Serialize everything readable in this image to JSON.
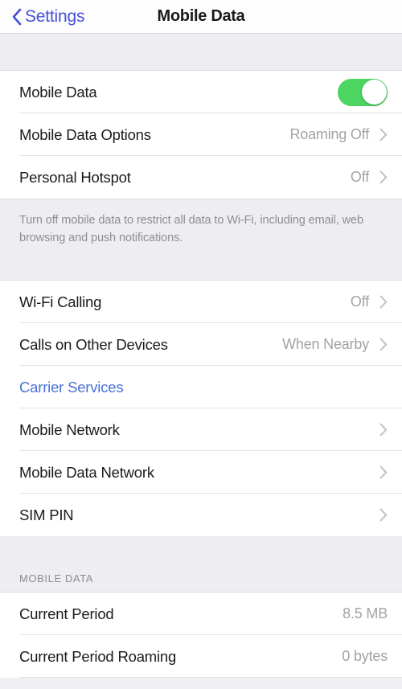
{
  "navbar": {
    "back_label": "Settings",
    "title": "Mobile Data"
  },
  "groups": [
    {
      "id": "data-group",
      "rows": [
        {
          "label": "Mobile Data",
          "control": "toggle",
          "toggle_on": true,
          "value": ""
        },
        {
          "label": "Mobile Data Options",
          "control": "chevron",
          "value": "Roaming Off"
        },
        {
          "label": "Personal Hotspot",
          "control": "chevron",
          "value": "Off"
        }
      ]
    },
    {
      "id": "calling-group",
      "rows": [
        {
          "label": "Wi-Fi Calling",
          "control": "chevron",
          "value": "Off"
        },
        {
          "label": "Calls on Other Devices",
          "control": "chevron",
          "value": "When Nearby"
        },
        {
          "label": "Carrier Services",
          "control": "none",
          "value": "",
          "style": "link"
        },
        {
          "label": "Mobile Network",
          "control": "chevron",
          "value": ""
        },
        {
          "label": "Mobile Data Network",
          "control": "chevron",
          "value": ""
        },
        {
          "label": "SIM PIN",
          "control": "chevron",
          "value": ""
        }
      ]
    },
    {
      "id": "usage-group",
      "header": "MOBILE DATA",
      "rows": [
        {
          "label": "Current Period",
          "control": "none",
          "value": "8.5 MB"
        },
        {
          "label": "Current Period Roaming",
          "control": "none",
          "value": "0 bytes"
        }
      ]
    }
  ],
  "footer_note": "Turn off mobile data to restrict all data to Wi-Fi, including email, web browsing and push notifications.",
  "colors": {
    "tint_back": "#4550d8",
    "tint_link": "#4a71d8",
    "toggle_on": "#4cd661",
    "value_gray": "#a3a3a8",
    "group_bg": "#ffffff",
    "page_bg": "#eeeef2"
  }
}
